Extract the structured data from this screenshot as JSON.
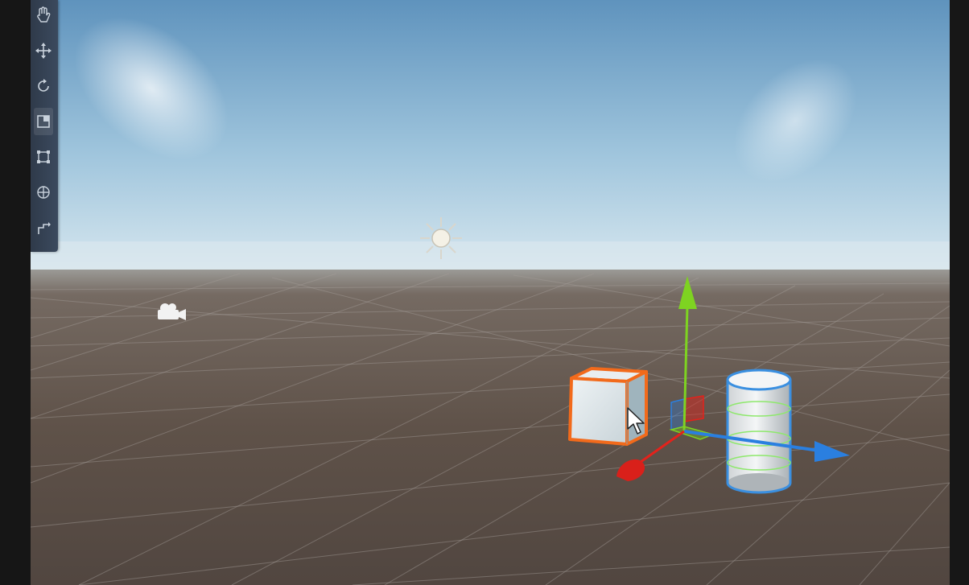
{
  "scene_view": {
    "colors": {
      "sky_top": "#5f93bd",
      "sky_horizon": "#d7e7ef",
      "ground": "#5e5148",
      "grid_line": "#a39e98",
      "selection_outline": "#f26a1b",
      "collider_green": "#8ee86c",
      "gizmo_x": "#e4221b",
      "gizmo_y": "#7ed321",
      "gizmo_z": "#2a7fe0"
    },
    "toolbar": {
      "tools": [
        "hand-tool",
        "move-tool",
        "rotate-tool",
        "scale-tool",
        "rect-tool",
        "transform-tool",
        "custom-tool"
      ]
    },
    "objects": [
      "directional-light",
      "main-camera",
      "cube",
      "cylinder"
    ]
  }
}
